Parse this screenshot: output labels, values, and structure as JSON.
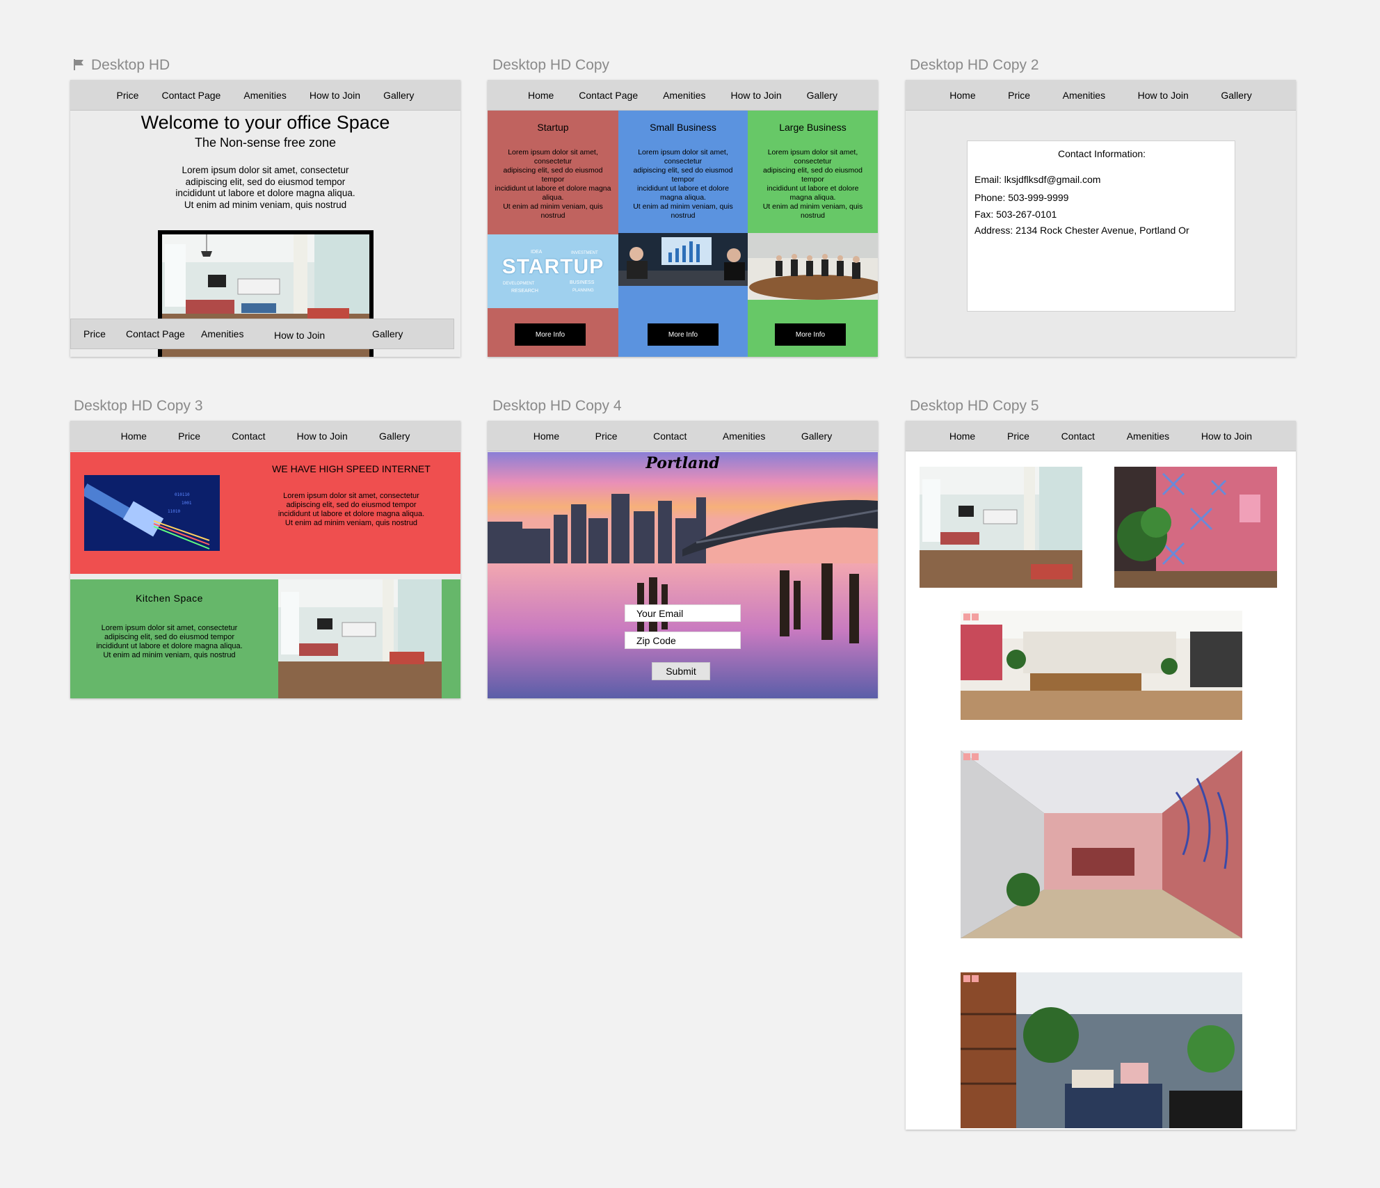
{
  "artboards": {
    "a1": {
      "label": "Desktop HD",
      "nav": [
        "Price",
        "Contact Page",
        "Amenities",
        "How to Join",
        "Gallery"
      ],
      "title": "Welcome to your office Space",
      "subtitle": "The Non-sense free zone",
      "body": "Lorem ipsum dolor sit amet, consectetur\nadipiscing elit, sed do eiusmod tempor\nincididunt ut labore et dolore magna aliqua.\nUt enim ad minim veniam, quis nostrud",
      "footer_nav": [
        "Price",
        "Contact Page",
        "Amenities",
        "How to Join",
        "Gallery"
      ]
    },
    "a2": {
      "label": "Desktop HD Copy",
      "nav": [
        "Home",
        "Contact Page",
        "Amenities",
        "How to Join",
        "Gallery"
      ],
      "plans": [
        {
          "title": "Startup",
          "body": "Lorem ipsum dolor sit amet,\nconsectetur\nadipiscing elit, sed do eiusmod\ntempor\nincididunt ut labore et dolore magna\naliqua.\nUt enim ad minim veniam, quis\nnostrud",
          "button": "More Info",
          "color": "#c0635f"
        },
        {
          "title": "Small Business",
          "body": "Lorem ipsum dolor sit amet,\nconsectetur\nadipiscing elit, sed do eiusmod\ntempor\nincididunt ut labore et dolore\nmagna aliqua.\nUt enim ad minim veniam, quis\nnostrud",
          "button": "More Info",
          "color": "#5b93df"
        },
        {
          "title": "Large Business",
          "body": "Lorem ipsum dolor sit amet,\nconsectetur\nadipiscing elit, sed do eiusmod\ntempor\nincididunt ut labore et dolore\nmagna aliqua.\nUt enim ad minim veniam, quis\nnostrud",
          "button": "More Info",
          "color": "#67c867"
        }
      ],
      "startup_img_text": "STARTUP",
      "startup_img_words": [
        "IDEA",
        "INVESTMENT",
        "DEVELOPMENT",
        "BUSINESS",
        "RESEARCH",
        "PLANNING"
      ]
    },
    "a3": {
      "label": "Desktop HD Copy 2",
      "nav": [
        "Home",
        "Price",
        "Amenities",
        "How to Join",
        "Gallery"
      ],
      "contact_heading": "Contact Information:",
      "email": "Email: lksjdflksdf@gmail.com",
      "phone": "Phone: 503-999-9999",
      "fax": "Fax: 503-267-0101",
      "address": "Address: 2134 Rock Chester Avenue, Portland Or"
    },
    "a4": {
      "label": "Desktop HD Copy 3",
      "nav": [
        "Home",
        "Price",
        "Contact",
        "How to Join",
        "Gallery"
      ],
      "internet_heading": "WE HAVE HIGH SPEED INTERNET",
      "internet_body": "Lorem ipsum dolor sit amet, consectetur\nadipiscing elit, sed do eiusmod tempor\nincididunt ut labore et dolore magna aliqua.\nUt enim ad minim veniam, quis nostrud",
      "kitchen_heading": "Kitchen Space",
      "kitchen_body": "Lorem ipsum dolor sit amet, consectetur\nadipiscing elit, sed do eiusmod tempor\nincididunt ut labore et dolore magna aliqua.\nUt enim ad minim veniam, quis nostrud"
    },
    "a5": {
      "label": "Desktop HD Copy 4",
      "nav": [
        "Home",
        "Price",
        "Contact",
        "Amenities",
        "Gallery"
      ],
      "city": "Portland",
      "email_placeholder": "Your Email",
      "zip_placeholder": "Zip Code",
      "submit": "Submit"
    },
    "a6": {
      "label": "Desktop HD Copy 5",
      "nav": [
        "Home",
        "Price",
        "Contact",
        "Amenities",
        "How to Join"
      ]
    }
  },
  "colors": {
    "canvas": "#f2f2f2",
    "nav_bg": "#d8d8d8",
    "internet_red": "#ef4f4f",
    "kitchen_green": "#66b76a"
  }
}
